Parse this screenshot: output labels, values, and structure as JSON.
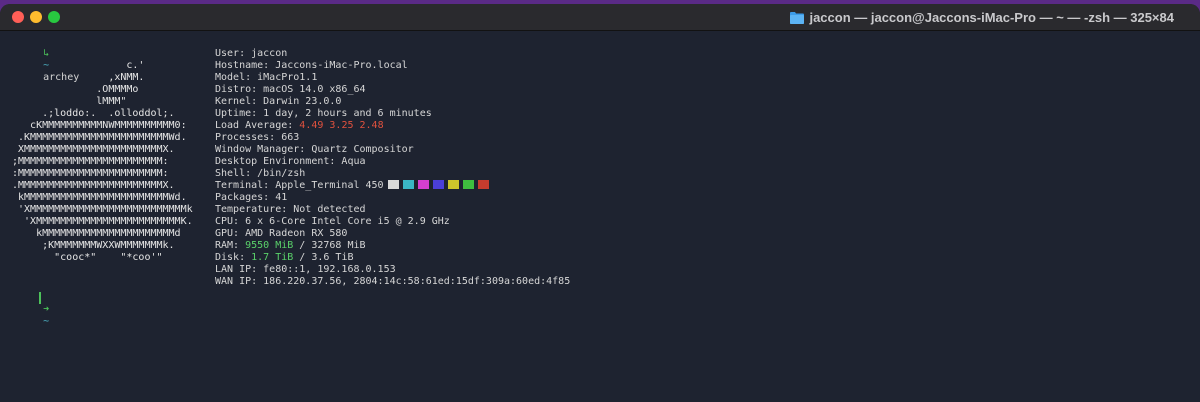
{
  "window": {
    "title": "jaccon — jaccon@Jaccons-iMac-Pro — ~ — -zsh — 325×84",
    "colors": {
      "background": "#1e2330",
      "titlebar": "#2a2a2e",
      "prompt": "#4cc15a"
    }
  },
  "terminal": {
    "prompt_first": "↳",
    "cwd": "~",
    "command": "archey",
    "prompt_second": "➜",
    "cwd_second": "~",
    "logo_lines": [
      "                   c.'",
      "                ,xNMM.",
      "              .OMMMMo",
      "              lMMM\"",
      "     .;loddo:.  .olloddol;.",
      "   cKMMMMMMMMMMNWMMMMMMMMMM0:",
      " .KMMMMMMMMMMMMMMMMMMMMMMMWd.",
      " XMMMMMMMMMMMMMMMMMMMMMMMX.",
      ";MMMMMMMMMMMMMMMMMMMMMMMM:",
      ":MMMMMMMMMMMMMMMMMMMMMMMM:",
      ".MMMMMMMMMMMMMMMMMMMMMMMMX.",
      " kMMMMMMMMMMMMMMMMMMMMMMMMWd.",
      " 'XMMMMMMMMMMMMMMMMMMMMMMMMMMk",
      "  'XMMMMMMMMMMMMMMMMMMMMMMMMK.",
      "    kMMMMMMMMMMMMMMMMMMMMMMd",
      "     ;KMMMMMMMWXXWMMMMMMMk.",
      "       \"cooc*\"    \"*coo'\""
    ],
    "info": {
      "user": "User: jaccon",
      "hostname": "Hostname: Jaccons-iMac-Pro.local",
      "model": "Model: iMacPro1.1",
      "distro": "Distro: macOS 14.0 x86_64",
      "kernel": "Kernel: Darwin 23.0.0",
      "uptime": "Uptime: 1 day, 2 hours and 6 minutes",
      "load_label": "Load Average: ",
      "load_values": "4.49 3.25 2.48",
      "processes": "Processes: 663",
      "window_manager": "Window Manager: Quartz Compositor",
      "desktop_environment": "Desktop Environment: Aqua",
      "shell": "Shell: /bin/zsh",
      "terminal": "Terminal: Apple_Terminal 450",
      "packages": "Packages: 41",
      "temperature": "Temperature: Not detected",
      "cpu": "CPU: 6 x 6-Core Intel Core i5 @ 2.9 GHz",
      "gpu": "GPU: AMD Radeon RX 580",
      "ram_label": "RAM: ",
      "ram_used": "9550 MiB",
      "ram_total": " / 32768 MiB",
      "disk_label": "Disk: ",
      "disk_used": "1.7 TiB",
      "disk_total": " / 3.6 TiB",
      "lan_ip": "LAN IP: fe80::1, 192.168.0.153",
      "wan_ip": "WAN IP: 186.220.37.56, 2804:14c:58:61ed:15df:309a:60ed:4f85"
    },
    "palette": [
      "#d9d9d9",
      "#3ab7c6",
      "#d43fd0",
      "#4b3fd9",
      "#cdc42b",
      "#3fbf3f",
      "#c73c2e"
    ]
  }
}
